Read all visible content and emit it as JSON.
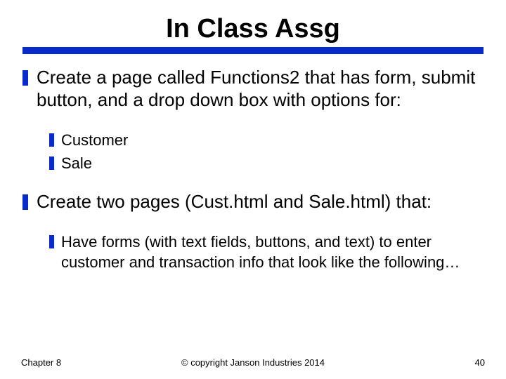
{
  "title": "In Class Assg",
  "bullets": [
    {
      "level": 1,
      "text": "Create a page called Functions2 that has form, submit button, and a drop down box with options for:"
    },
    {
      "level": 2,
      "text": "Customer"
    },
    {
      "level": 2,
      "text": "Sale"
    },
    {
      "level": 1,
      "text": "Create two pages (Cust.html and Sale.html) that:"
    },
    {
      "level": 2,
      "text": "Have forms (with text fields, buttons, and text) to enter customer and transaction info that look like the following…"
    }
  ],
  "footer": {
    "left": "Chapter 8",
    "center": "© copyright Janson Industries 2014",
    "right": "40"
  }
}
